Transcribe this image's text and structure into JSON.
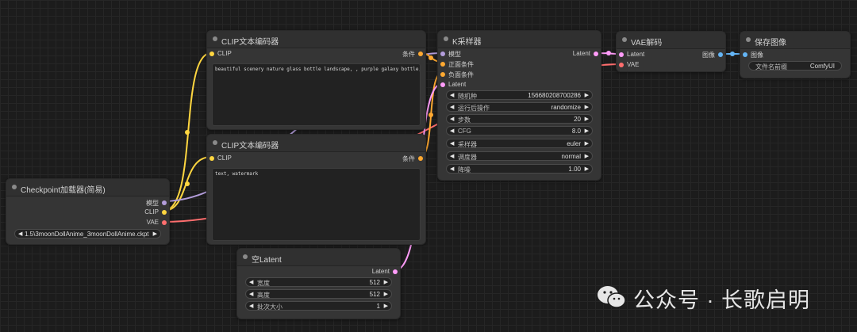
{
  "colors": {
    "model_port": "#b39ddb",
    "clip_port": "#ffd640",
    "conditioning_port": "#ffa931",
    "latent_port": "#ff9cf9",
    "vae_port": "#ff6e6e",
    "image_port": "#64b5f6"
  },
  "nodes": {
    "checkpoint": {
      "title": "Checkpoint加载器(简易)",
      "outputs": [
        "模型",
        "CLIP",
        "VAE"
      ],
      "ckpt_name": "1.5\\3moonDollAnime_3moonDollAnime.ckpt"
    },
    "clip_pos": {
      "title": "CLIP文本编码器",
      "input": "CLIP",
      "output": "条件",
      "text": "beautiful scenery nature glass bottle landscape, , purple galaxy bottle,"
    },
    "clip_neg": {
      "title": "CLIP文本编码器",
      "input": "CLIP",
      "output": "条件",
      "text": "text, watermark"
    },
    "ksampler": {
      "title": "K采样器",
      "inputs": [
        "模型",
        "正面条件",
        "负面条件",
        "Latent"
      ],
      "output": "Latent",
      "widgets": [
        {
          "label": "随机种",
          "value": "156680208700286"
        },
        {
          "label": "运行后操作",
          "value": "randomize"
        },
        {
          "label": "步数",
          "value": "20"
        },
        {
          "label": "CFG",
          "value": "8.0"
        },
        {
          "label": "采样器",
          "value": "euler"
        },
        {
          "label": "调度器",
          "value": "normal"
        },
        {
          "label": "降噪",
          "value": "1.00"
        }
      ]
    },
    "vae_decode": {
      "title": "VAE解码",
      "inputs": [
        "Latent",
        "VAE"
      ],
      "output": "图像"
    },
    "save_image": {
      "title": "保存图像",
      "input": "图像",
      "prefix_label": "文件名前缀",
      "prefix_value": "ComfyUI"
    },
    "empty_latent": {
      "title": "空Latent",
      "output": "Latent",
      "widgets": [
        {
          "label": "宽度",
          "value": "512"
        },
        {
          "label": "高度",
          "value": "512"
        },
        {
          "label": "批次大小",
          "value": "1"
        }
      ]
    }
  },
  "watermark": {
    "icon": "wechat-icon",
    "text": "公众号 · 长歌启明"
  }
}
